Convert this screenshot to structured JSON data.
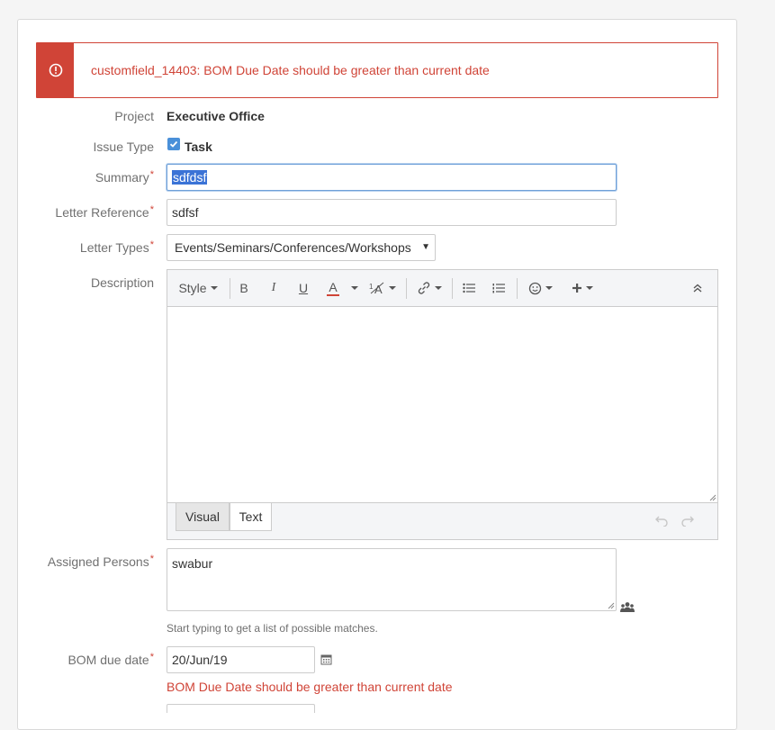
{
  "error_banner": {
    "message": "customfield_14403: BOM Due Date should be greater than current date",
    "icon": "error-circle-icon",
    "color": "#d04437"
  },
  "fields": {
    "project": {
      "label": "Project",
      "value": "Executive Office"
    },
    "issue_type": {
      "label": "Issue Type",
      "value": "Task",
      "icon": "task-checkbox-icon"
    },
    "summary": {
      "label": "Summary",
      "value": "sdfdsf",
      "required": "*"
    },
    "letter_reference": {
      "label": "Letter Reference",
      "value": "sdfsf",
      "required": "*"
    },
    "letter_types": {
      "label": "Letter Types",
      "value": "Events/Seminars/Conferences/Workshops",
      "required": "*"
    },
    "description": {
      "label": "Description"
    },
    "assigned_persons": {
      "label": "Assigned Persons",
      "value": "swabur",
      "required": "*",
      "hint": "Start typing to get a list of possible matches."
    },
    "bom_due_date": {
      "label": "BOM due date",
      "value": "20/Jun/19",
      "required": "*",
      "error": "BOM Due Date should be greater than current date"
    }
  },
  "editor": {
    "style_label": "Style",
    "bold": "B",
    "italic": "I",
    "underline": "U",
    "text_color": "A",
    "tabs": {
      "visual": "Visual",
      "text": "Text"
    }
  }
}
